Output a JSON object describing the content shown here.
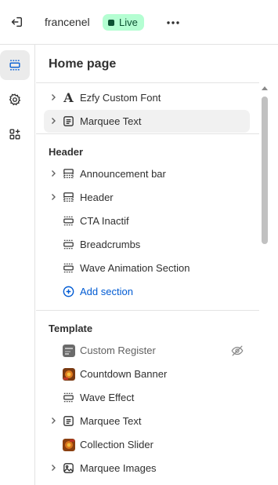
{
  "topbar": {
    "store_name": "francenel",
    "status_badge": "Live",
    "exit_icon": "exit-icon",
    "more_icon": "more-horizontal-icon"
  },
  "rail": {
    "items": [
      {
        "icon": "sections-icon",
        "active": true
      },
      {
        "icon": "settings-gear-icon",
        "active": false
      },
      {
        "icon": "apps-icon",
        "active": false
      }
    ]
  },
  "panel": {
    "title": "Home page",
    "top_items": [
      {
        "label": "Ezfy Custom Font",
        "icon": "font-icon",
        "expandable": true
      },
      {
        "label": "Marquee Text",
        "icon": "text-block-icon",
        "expandable": true,
        "highlighted": true
      }
    ],
    "header_group": {
      "title": "Header",
      "items": [
        {
          "label": "Announcement bar",
          "icon": "header-section-icon",
          "expandable": true
        },
        {
          "label": "Header",
          "icon": "header-section-icon",
          "expandable": true
        },
        {
          "label": "CTA Inactif",
          "icon": "section-icon",
          "expandable": false
        },
        {
          "label": "Breadcrumbs",
          "icon": "section-icon",
          "expandable": false
        },
        {
          "label": "Wave Animation Section",
          "icon": "section-icon",
          "expandable": false
        }
      ],
      "add_section": "Add section"
    },
    "template_group": {
      "title": "Template",
      "items": [
        {
          "label": "Custom Register",
          "icon": "app-image-icon",
          "expandable": false,
          "hidden": true
        },
        {
          "label": "Countdown Banner",
          "icon": "app-image-icon",
          "expandable": false
        },
        {
          "label": "Wave Effect",
          "icon": "section-icon",
          "expandable": false
        },
        {
          "label": "Marquee Text",
          "icon": "text-block-icon",
          "expandable": true
        },
        {
          "label": "Collection Slider",
          "icon": "app-image-icon",
          "expandable": false
        },
        {
          "label": "Marquee Images",
          "icon": "image-icon",
          "expandable": true
        }
      ]
    }
  },
  "colors": {
    "live_badge_bg": "#b4fed2",
    "live_badge_text": "#0c5132",
    "link": "#005bd3",
    "row_highlight": "#f1f1f1"
  }
}
